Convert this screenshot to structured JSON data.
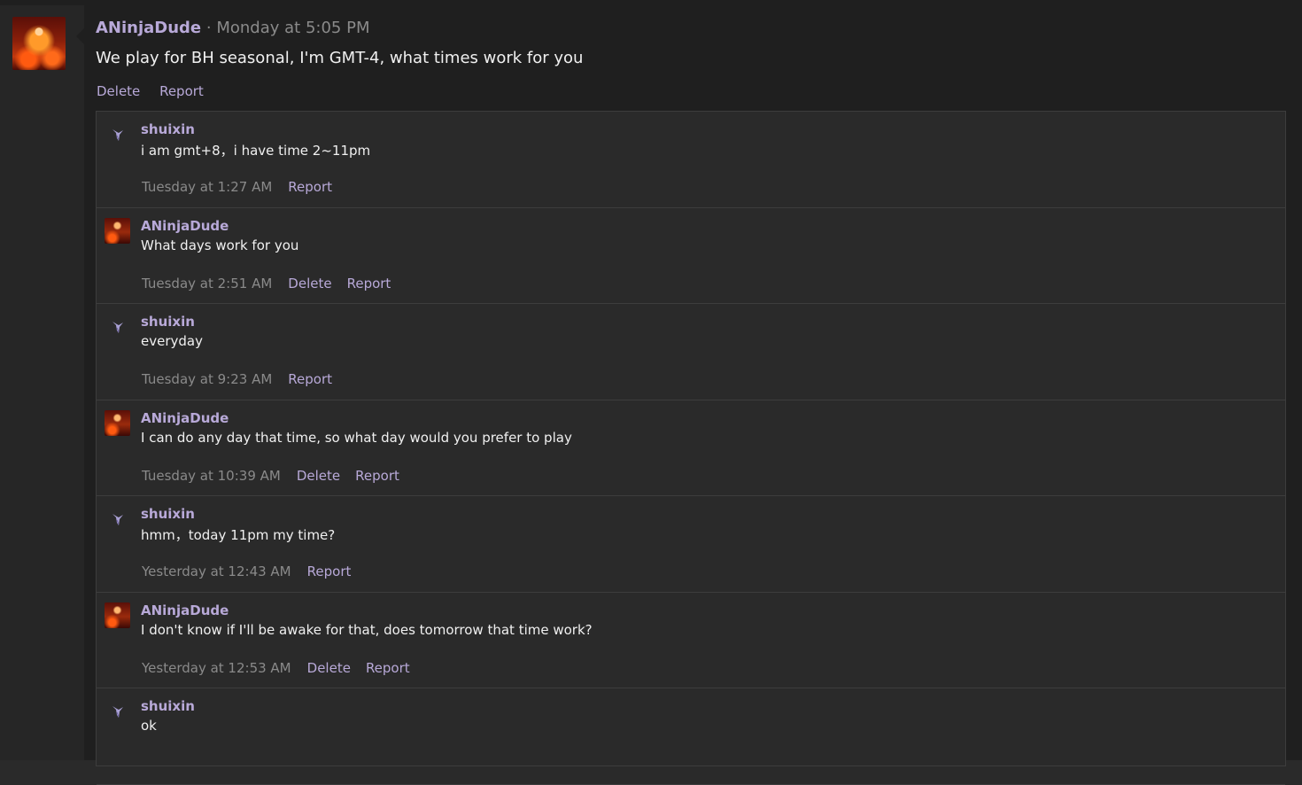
{
  "post": {
    "author": "ANinjaDude",
    "separator": "·",
    "timestamp": "Monday at 5:05 PM",
    "body": "We play for BH seasonal, I'm GMT-4, what times work for you",
    "actions": {
      "delete": "Delete",
      "report": "Report"
    },
    "avatar_icon": "flame-avatar-icon"
  },
  "comments": [
    {
      "author": "shuixin",
      "avatar_icon": "bird-avatar-icon",
      "text": "i am gmt+8，i have time 2~11pm",
      "time": "Tuesday at 1:27 AM",
      "delete": "",
      "report": "Report"
    },
    {
      "author": "ANinjaDude",
      "avatar_icon": "flame-avatar-icon",
      "text": "What days work for you",
      "time": "Tuesday at 2:51 AM",
      "delete": "Delete",
      "report": "Report"
    },
    {
      "author": "shuixin",
      "avatar_icon": "bird-avatar-icon",
      "text": "everyday",
      "time": "Tuesday at 9:23 AM",
      "delete": "",
      "report": "Report"
    },
    {
      "author": "ANinjaDude",
      "avatar_icon": "flame-avatar-icon",
      "text": "I can do any day that time, so what day would you prefer to play",
      "time": "Tuesday at 10:39 AM",
      "delete": "Delete",
      "report": "Report"
    },
    {
      "author": "shuixin",
      "avatar_icon": "bird-avatar-icon",
      "text": "hmm，today 11pm my time?",
      "time": "Yesterday at 12:43 AM",
      "delete": "",
      "report": "Report"
    },
    {
      "author": "ANinjaDude",
      "avatar_icon": "flame-avatar-icon",
      "text": "I don't know if I'll be awake for that, does tomorrow that time work?",
      "time": "Yesterday at 12:53 AM",
      "delete": "Delete",
      "report": "Report"
    },
    {
      "author": "shuixin",
      "avatar_icon": "bird-avatar-icon",
      "text": "ok",
      "time": "",
      "delete": "",
      "report": ""
    }
  ],
  "colors": {
    "accent": "#b8a9d8",
    "muted": "#8a8a8a",
    "text": "#f0f0f0",
    "panel": "#1f1f1f",
    "comments_bg": "#2a2a2a"
  }
}
